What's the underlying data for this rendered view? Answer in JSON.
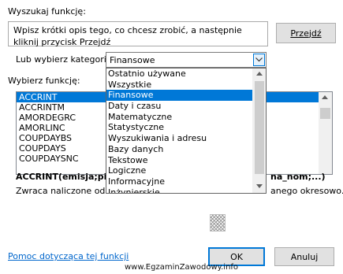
{
  "search": {
    "label": "Wyszukaj funkcję:",
    "description": "Wpisz krótki opis tego, co chcesz zrobić, a następnie kliknij przycisk Przejdź",
    "go_button": "Przejdź"
  },
  "category": {
    "label": "Lub wybierz kategorię:",
    "selected": "Finansowe",
    "options": [
      "Ostatnio używane",
      "Wszystkie",
      "Finansowe",
      "Daty i czasu",
      "Matematyczne",
      "Statystyczne",
      "Wyszukiwania i adresu",
      "Bazy danych",
      "Tekstowe",
      "Logiczne",
      "Informacyjne",
      "Inżynierskie"
    ]
  },
  "functions": {
    "label": "Wybierz funkcję:",
    "items": [
      "ACCRINT",
      "ACCRINTM",
      "AMORDEGRC",
      "AMORLINC",
      "COUPDAYBS",
      "COUPDAYS",
      "COUPDAYSNC"
    ],
    "signature_left": "ACCRINT(emisja;pie",
    "signature_right": "na_nom;...)",
    "description_left": "Zwraca naliczone odset",
    "description_right": "anego okresowo."
  },
  "footer": {
    "help_link": "Pomoc dotycząca tej funkcji",
    "ok_button": "OK",
    "cancel_button": "Anuluj"
  },
  "watermark": "www.EgzaminZawodowy.info",
  "icons": {
    "dropdown": "chevron-down-icon",
    "scroll_up": "triangle-up-icon",
    "scroll_down": "triangle-down-icon"
  }
}
